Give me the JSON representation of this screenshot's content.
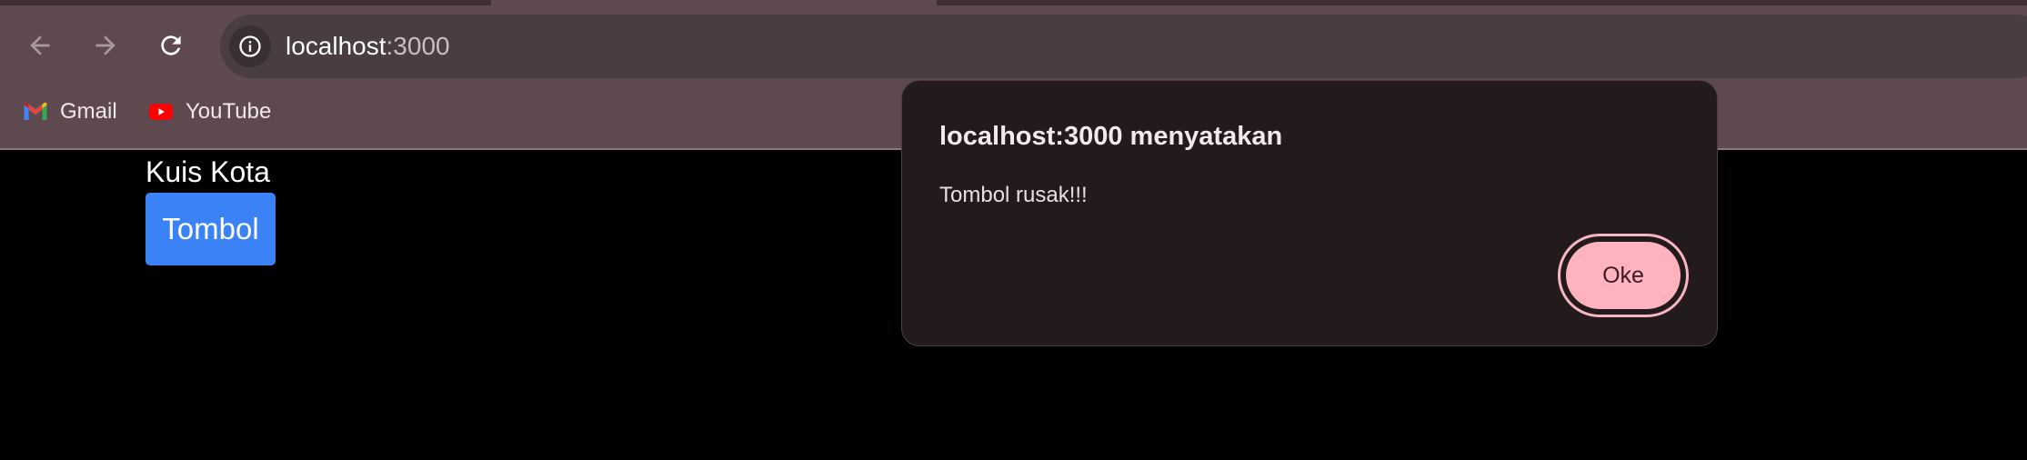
{
  "browser": {
    "address_host": "localhost",
    "address_port": ":3000",
    "bookmarks": [
      {
        "label": "Gmail",
        "icon": "gmail-icon"
      },
      {
        "label": "YouTube",
        "icon": "youtube-icon"
      }
    ],
    "icons": {
      "back": "back-arrow-icon",
      "forward": "forward-arrow-icon",
      "reload": "reload-icon",
      "site_info": "info-icon"
    }
  },
  "page": {
    "heading": "Kuis Kota",
    "button_label": "Tombol",
    "button_color": "#3b82f6"
  },
  "dialog": {
    "title": "localhost:3000 menyatakan",
    "message": "Tombol rusak!!!",
    "ok_label": "Oke",
    "accent": "#ffb3bf"
  }
}
